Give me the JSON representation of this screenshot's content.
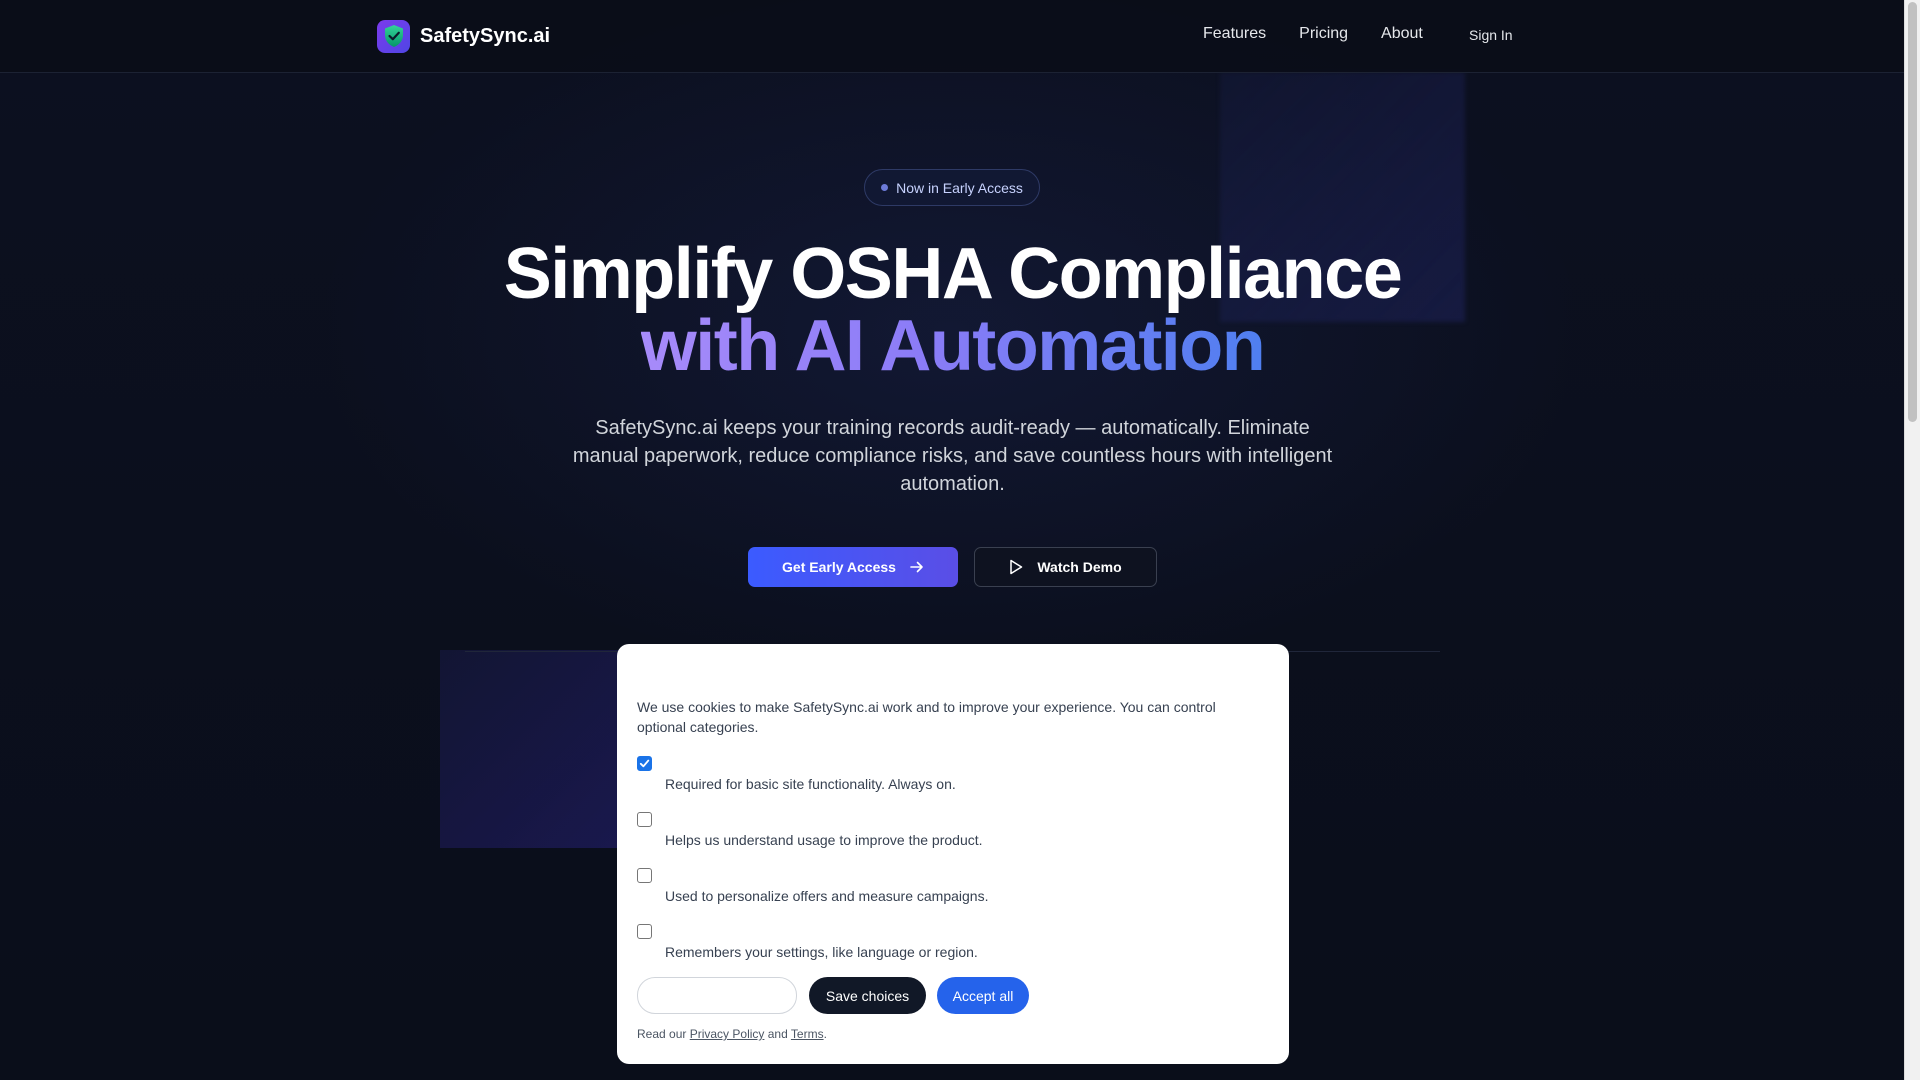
{
  "header": {
    "brand": "SafetySync.ai",
    "nav": [
      "Features",
      "Pricing",
      "About"
    ],
    "sign_in": "Sign In"
  },
  "hero": {
    "badge": "Now in Early Access",
    "title_line1": "Simplify OSHA Compliance",
    "title_line2": "with AI Automation",
    "subtitle": "SafetySync.ai keeps your training records audit-ready — automatically. Eliminate manual paperwork, reduce compliance risks, and save countless hours with intelligent automation.",
    "cta_primary": "Get Early Access",
    "cta_secondary": "Watch Demo"
  },
  "cookie": {
    "intro": "We use cookies to make SafetySync.ai work and to improve your experience. You can control optional categories.",
    "options": [
      {
        "desc": "Required for basic site functionality. Always on.",
        "checked": true
      },
      {
        "desc": "Helps us understand usage to improve the product.",
        "checked": false
      },
      {
        "desc": "Used to personalize offers and measure campaigns.",
        "checked": false
      },
      {
        "desc": "Remembers your settings, like language or region.",
        "checked": false
      }
    ],
    "input_value": "",
    "save_label": "Save choices",
    "accept_label": "Accept all",
    "footer_prefix": "Read our",
    "privacy_link": "Privacy Policy",
    "footer_and": "and",
    "terms_link": "Terms",
    "footer_suffix": "."
  },
  "colors": {
    "accent_blue": "#2563eb",
    "gradient_start": "#a78bfa",
    "gradient_end": "#4f7ff0",
    "logo_tile": "#6d3ef0",
    "page_bg": "#0b0f1c"
  },
  "icons": {
    "logo": "shield-check-icon",
    "cta_arrow": "arrow-right-icon",
    "demo": "play-icon"
  }
}
